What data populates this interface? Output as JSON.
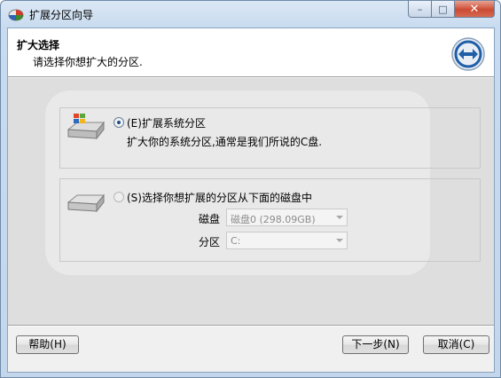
{
  "window": {
    "title": "扩展分区向导"
  },
  "controls": {
    "minimize": "–",
    "maximize": "□",
    "close": "✕"
  },
  "header": {
    "title": "扩大选择",
    "subtitle": "请选择你想扩大的分区."
  },
  "options": [
    {
      "label": "(E)扩展系统分区",
      "description": "扩大你的系统分区,通常是我们所说的C盘.",
      "checked": true,
      "icon": "windows-drive-icon"
    },
    {
      "label": "(S)选择你想扩展的分区从下面的磁盘中",
      "checked": false,
      "icon": "hard-drive-icon",
      "fields": {
        "disk_label": "磁盘",
        "disk_value": "磁盘0 (298.09GB)",
        "partition_label": "分区",
        "partition_value": "C:"
      }
    }
  ],
  "buttons": {
    "help": "帮助(H)",
    "next": "下一步(N)",
    "cancel": "取消(C)"
  },
  "colors": {
    "title_gradient": "#c8dbef",
    "close_button": "#cc4b33",
    "logo_ring": "#1f5fa8"
  }
}
